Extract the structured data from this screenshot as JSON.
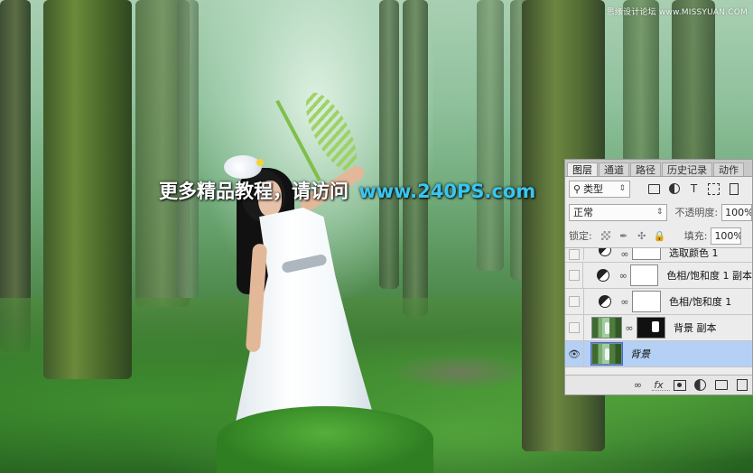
{
  "watermark": "思缘设计论坛 www.MISSYUAN.COM",
  "headline": {
    "chinese": "更多精品教程，请访问",
    "url": "www.240PS.com"
  },
  "layers_panel": {
    "tabs": [
      "图层",
      "通道",
      "路径",
      "历史记录",
      "动作"
    ],
    "active_tab": "图层",
    "filter": {
      "icon": "search-icon",
      "label": "类型"
    },
    "filter_icons": [
      "image-filter-icon",
      "adjustment-filter-icon",
      "text-filter-icon",
      "shape-filter-icon",
      "smart-object-filter-icon"
    ],
    "blend_mode": "正常",
    "opacity_label": "不透明度:",
    "opacity_value": "100%",
    "lock_label": "锁定:",
    "fill_label": "填充:",
    "fill_value": "100%",
    "layers": [
      {
        "name": "选取颜色 1",
        "visible": false,
        "kind": "adjustment",
        "partial": true
      },
      {
        "name": "色相/饱和度 1 副本",
        "visible": false,
        "kind": "adjustment"
      },
      {
        "name": "色相/饱和度 1",
        "visible": false,
        "kind": "adjustment"
      },
      {
        "name": "背景 副本",
        "visible": false,
        "kind": "image-with-mask"
      },
      {
        "name": "背景",
        "visible": true,
        "kind": "image",
        "selected": true,
        "italic": true
      }
    ],
    "bottom_icons": [
      "link-layers-icon",
      "fx-icon",
      "add-mask-icon",
      "adjustment-layer-icon",
      "new-group-icon",
      "new-layer-icon"
    ]
  },
  "colors": {
    "headline_text": "#ffffff",
    "headline_url": "#39c6f0",
    "selected_layer": "#b4d0f5",
    "panel_bg": "#ececec"
  }
}
